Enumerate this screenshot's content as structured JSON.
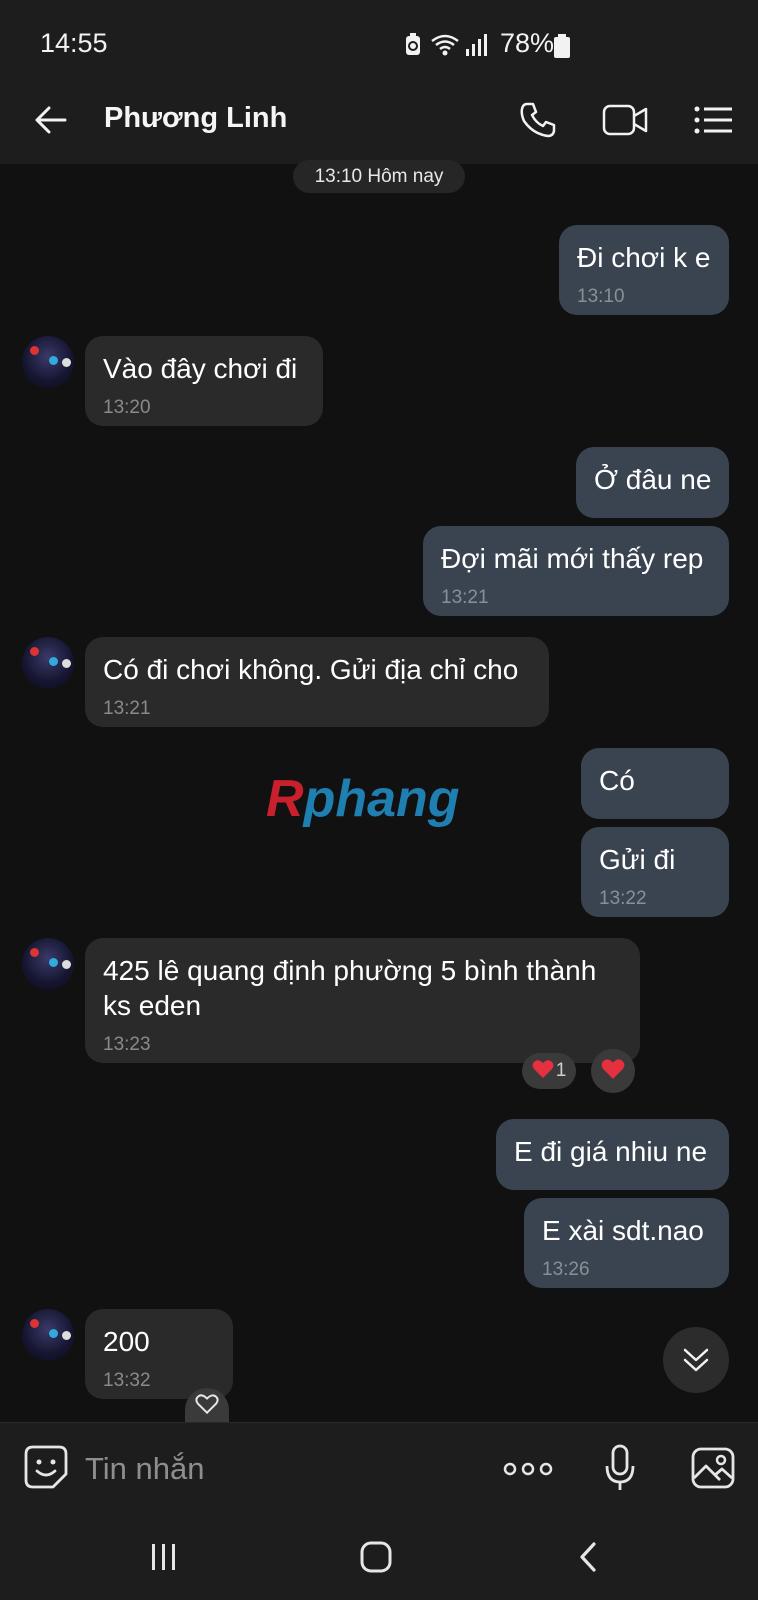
{
  "status_bar": {
    "time": "14:55",
    "battery_percent": "78%",
    "icons": [
      "battery-saver-icon",
      "wifi-icon",
      "signal-icon",
      "battery-icon"
    ]
  },
  "header": {
    "title": "Phương Linh",
    "icons": [
      "back-arrow-icon",
      "phone-icon",
      "video-call-icon",
      "menu-list-icon"
    ]
  },
  "date_chip": "13:10 Hôm nay",
  "messages": [
    {
      "dir": "out",
      "text": "Đi chơi k e",
      "time": "13:10"
    },
    {
      "dir": "in",
      "text": "Vào đây chơi đi",
      "time": "13:20"
    },
    {
      "dir": "out",
      "text": "Ở đâu ne",
      "time": ""
    },
    {
      "dir": "out",
      "text": "Đợi mãi mới thấy rep",
      "time": "13:21"
    },
    {
      "dir": "in",
      "text": "Có đi chơi không. Gửi địa chỉ cho",
      "time": "13:21"
    },
    {
      "dir": "out",
      "text": "Có",
      "time": ""
    },
    {
      "dir": "out",
      "text": "Gửi đi",
      "time": "13:22"
    },
    {
      "dir": "in",
      "text_line1": "425 lê quang định phường 5 bình thành",
      "text_line2": "ks eden",
      "time": "13:23"
    },
    {
      "dir": "out",
      "text": "E đi giá nhiu ne",
      "time": ""
    },
    {
      "dir": "out",
      "text": "E xài sdt.nao",
      "time": "13:26"
    },
    {
      "dir": "in",
      "text": "200",
      "time": "13:32"
    }
  ],
  "reactions": {
    "heart_count": "1"
  },
  "watermark": "Rphang",
  "input": {
    "placeholder": "Tin nhắn"
  },
  "accent": {
    "out_bubble": "#3a4451",
    "in_bubble": "#2a2a2a",
    "heart": "#e5303f"
  }
}
